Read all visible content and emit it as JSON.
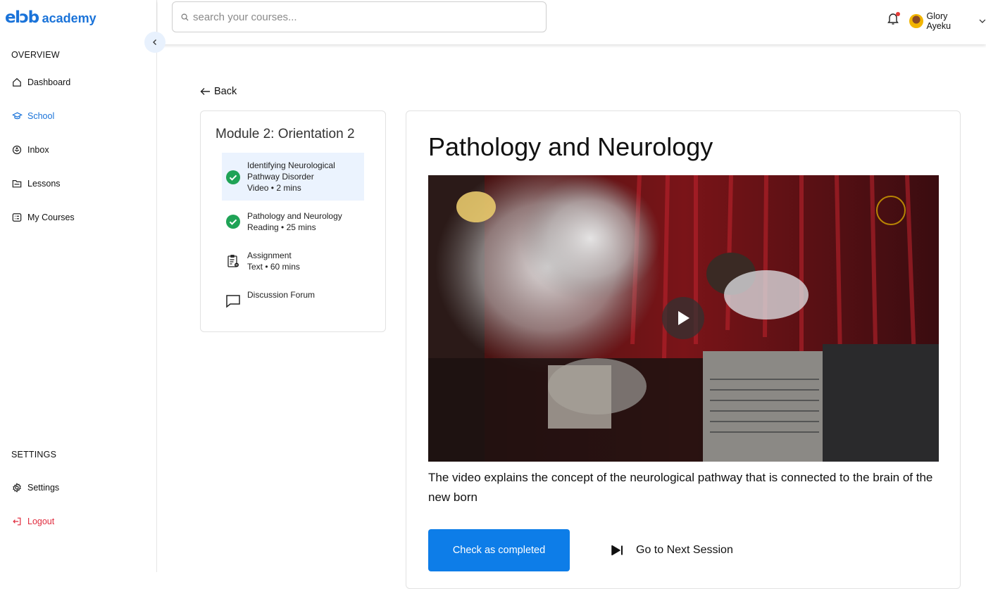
{
  "brand": {
    "mark": "elɔb",
    "word": "academy",
    "color": "#1a73d9"
  },
  "sidebar": {
    "overview_title": "OVERVIEW",
    "items": [
      {
        "label": "Dashboard",
        "icon": "home-icon"
      },
      {
        "label": "School",
        "icon": "graduation-cap-icon",
        "active": true
      },
      {
        "label": "Inbox",
        "icon": "inbox-icon"
      },
      {
        "label": "Lessons",
        "icon": "folder-icon"
      },
      {
        "label": "My Courses",
        "icon": "courses-list-icon"
      }
    ],
    "settings_title": "SETTINGS",
    "settings_items": [
      {
        "label": "Settings",
        "icon": "gear-icon"
      },
      {
        "label": "Logout",
        "icon": "logout-icon",
        "color": "#e02b3d"
      }
    ]
  },
  "search": {
    "placeholder": "search your courses..."
  },
  "user": {
    "name": "Glory Ayeku"
  },
  "back_label": "Back",
  "module": {
    "title": "Module 2: Orientation 2",
    "lessons": [
      {
        "title": "Identifying Neurological Pathway Disorder",
        "meta": "Video • 2 mins",
        "status": "completed",
        "selected": true
      },
      {
        "title": "Pathology and Neurology",
        "meta": "Reading • 25 mins",
        "status": "completed"
      },
      {
        "title": "Assignment",
        "meta": "Text • 60 mins",
        "status": "assignment-icon"
      },
      {
        "title": "Discussion Forum",
        "meta": "",
        "status": "chat-bubble-icon"
      }
    ]
  },
  "content": {
    "title": "Pathology and Neurology",
    "description": "The video explains the concept of the neurological pathway that is connected to the brain of the new born",
    "complete_button": "Check as completed",
    "next_label": "Go to Next Session"
  },
  "colors": {
    "accent": "#0d7de8",
    "success": "#1fa356",
    "selected_bg": "#ebf3fe"
  }
}
